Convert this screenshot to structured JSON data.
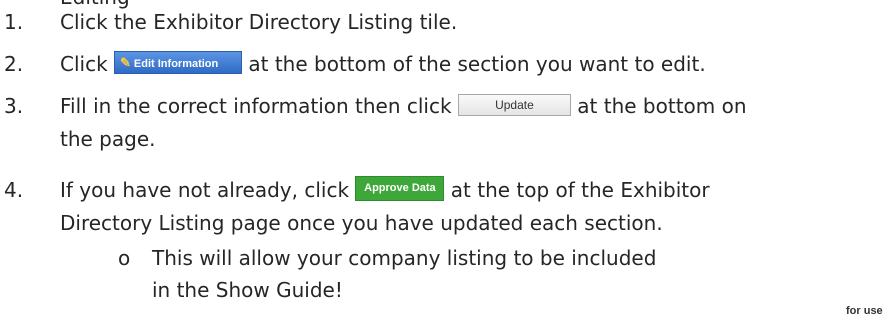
{
  "header_fragment": "Editing",
  "steps": [
    {
      "number": "1.",
      "text": "Click the Exhibitor Directory Listing tile."
    },
    {
      "number": "2.",
      "before": "Click",
      "button_label": "Edit Information",
      "after": "at the bottom of the section you want to edit."
    },
    {
      "number": "3.",
      "before": "Fill in the correct information then click",
      "button_label": "Update",
      "after": "at the bottom on",
      "line2": "the page."
    },
    {
      "number": "4.",
      "before": "If you have not already, click",
      "button_label": "Approve Data",
      "after": "at the top of the Exhibitor",
      "line2": "Directory Listing page once you have updated each section."
    }
  ],
  "sub_bullet": {
    "marker": "o",
    "line1": "This will allow your company listing to be included",
    "line2": "in the Show Guide!"
  },
  "side_note": "for use",
  "colors": {
    "edit_button": "#3a78d6",
    "approve_button": "#3ea73a",
    "update_button": "#ececec",
    "text": "#262626"
  },
  "icons": {
    "edit_button_icon": "pencil-icon"
  }
}
